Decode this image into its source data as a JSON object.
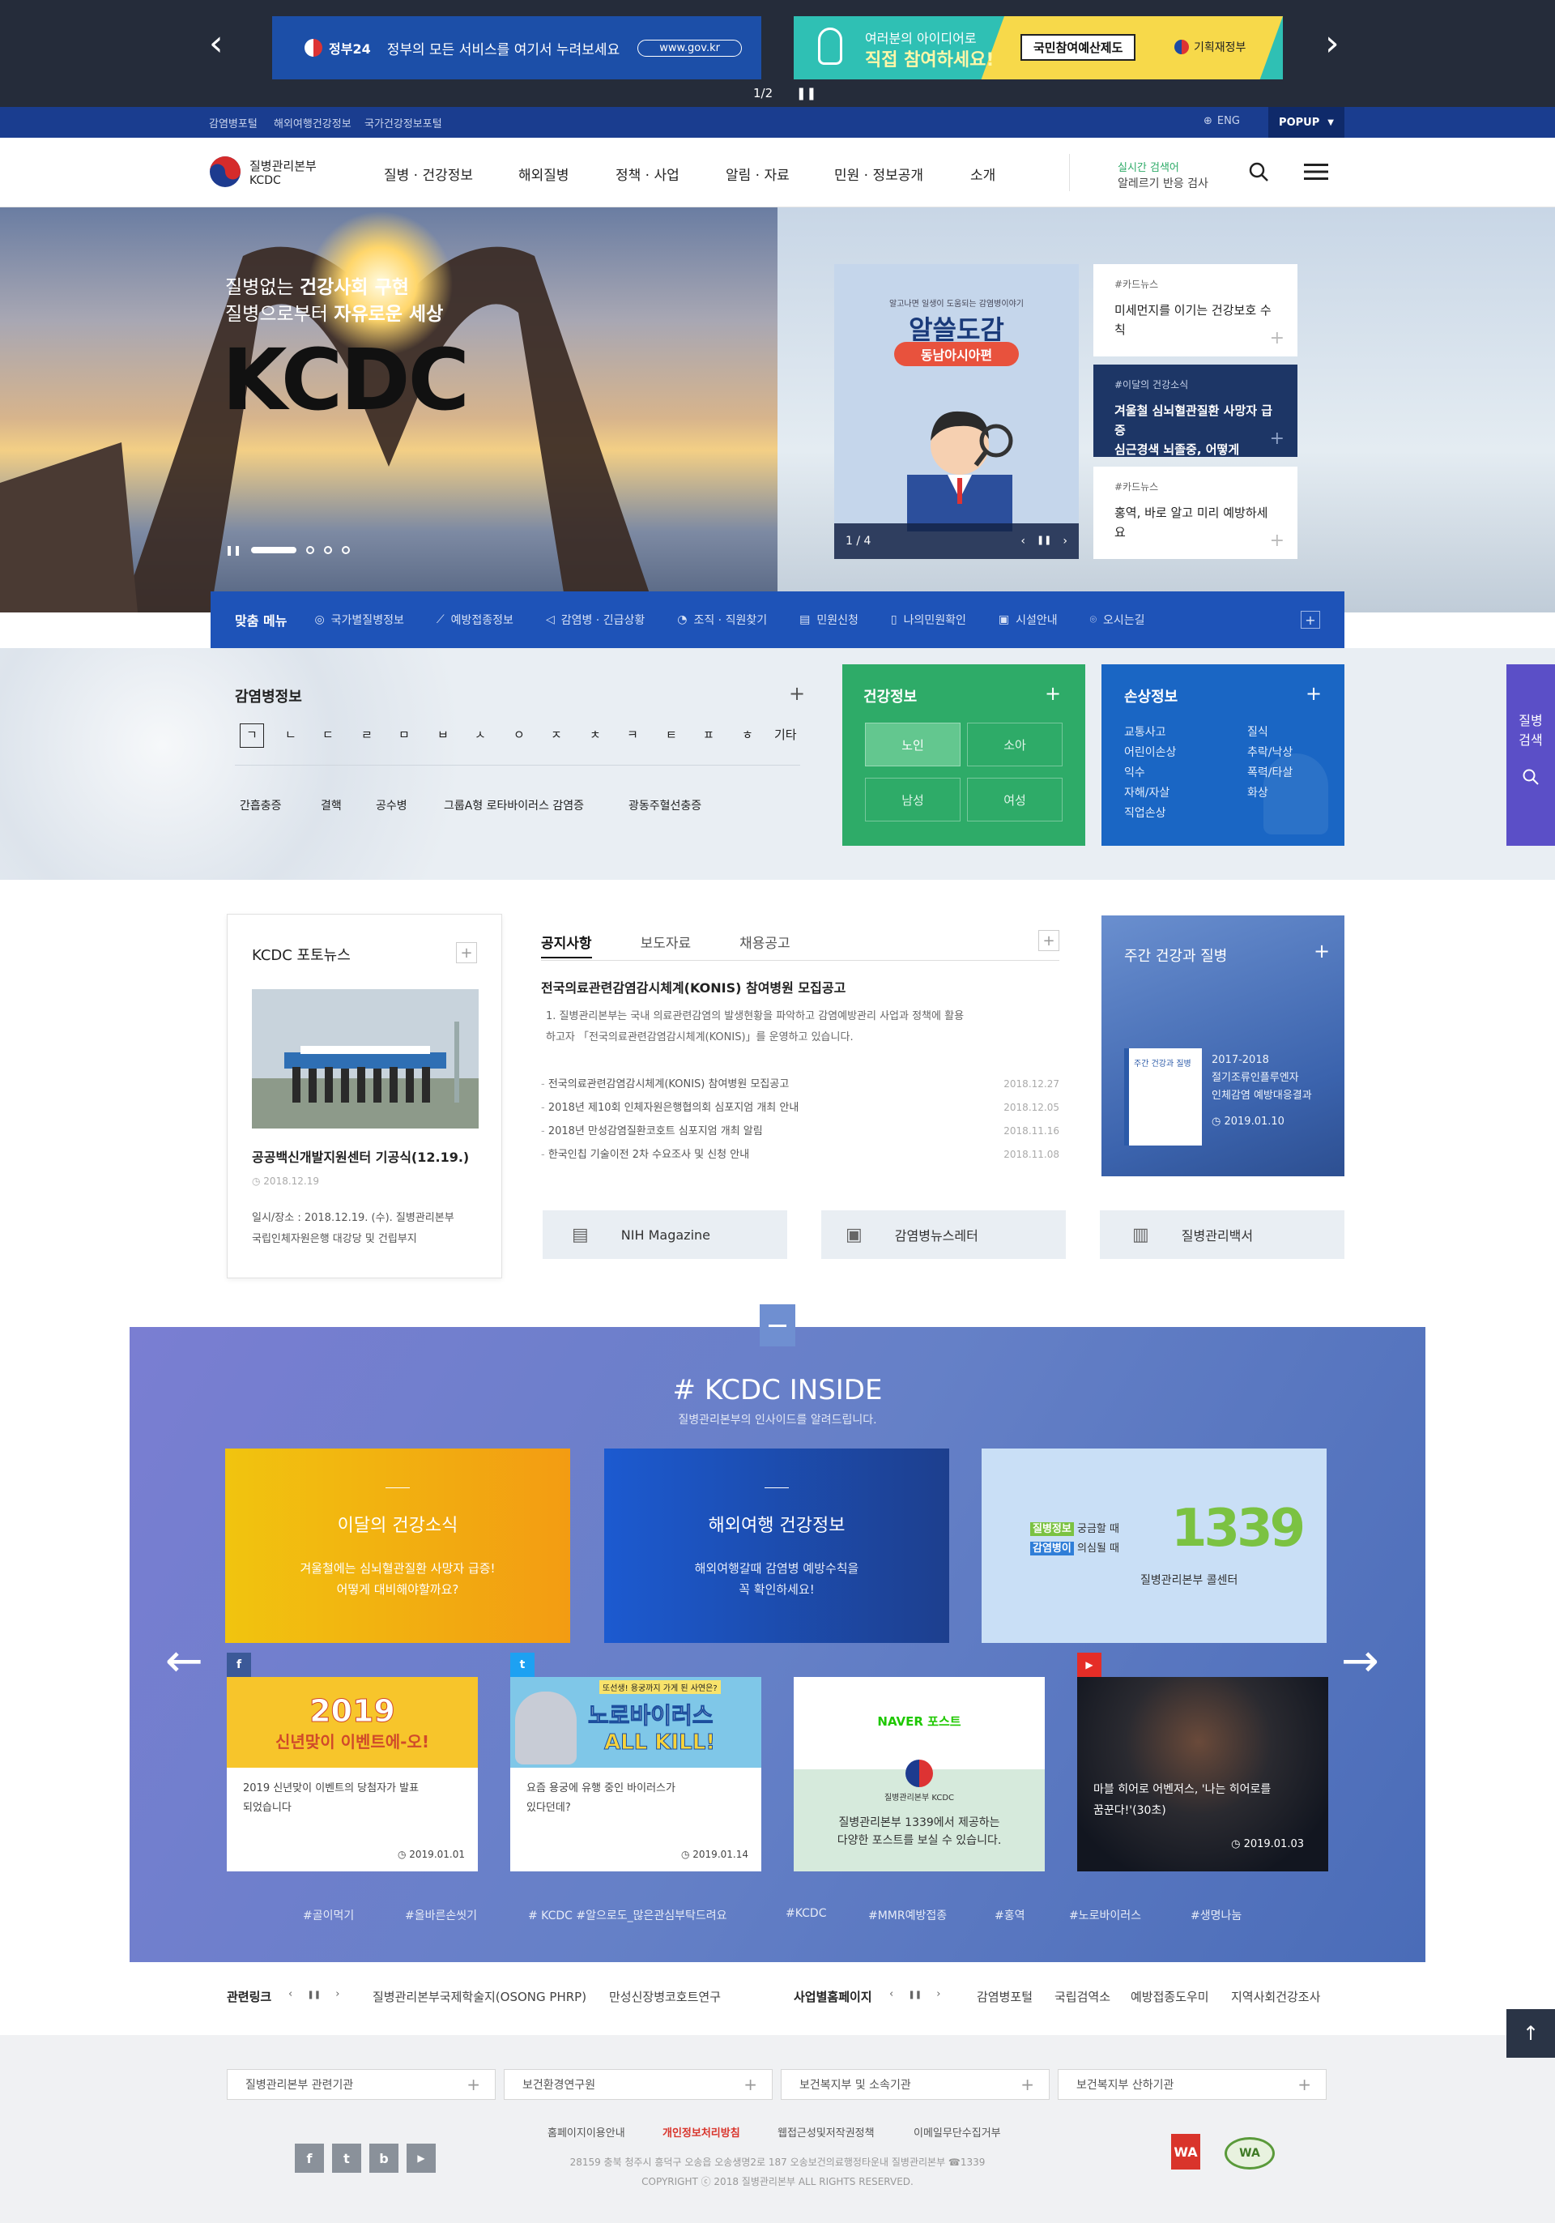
{
  "top_banner": {
    "gov24_logo": "정부24",
    "gov24_text": "정부의 모든 서비스를 여기서 누려보세요",
    "gov24_url": "www.gov.kr",
    "budget_line1": "여러분의 아이디어로",
    "budget_line2": "직접 참여하세요!",
    "budget_box": "국민참여예산제도",
    "budget_org": "기획재정부",
    "pager": "1/2"
  },
  "util": {
    "links": [
      "감염병포털",
      "해외여행건강정보",
      "국가건강정보포털"
    ],
    "lang": "ENG",
    "popup": "POPUP"
  },
  "header": {
    "logo_ko": "질병관리본부",
    "logo_en": "KCDC",
    "nav": [
      "질병 · 건강정보",
      "해외질병",
      "정책 · 사업",
      "알림 · 자료",
      "민원 · 정보공개",
      "소개"
    ],
    "realtime_label": "실시간 검색어",
    "realtime_value": "알레르기 반응 검사"
  },
  "hero": {
    "line1_a": "질병없는 ",
    "line1_b": "건강사회 구현",
    "line2_a": "질병으로부터 ",
    "line2_b": "자유로운 세상",
    "big": "KCDC",
    "bigcard_small": "알고나면 일생이 도움되는 감염병이야기",
    "bigcard_title": "알쓸도감",
    "bigcard_sub": "동남아시아편",
    "bigcard_pager": "1 / 4",
    "news": [
      {
        "tag": "#카드뉴스",
        "title": "미세먼지를 이기는 건강보호 수칙"
      },
      {
        "tag": "#이달의 건강소식",
        "title": "겨울철 심뇌혈관질환 사망자 급증\n심근경색 뇌졸중, 어떻게"
      },
      {
        "tag": "#카드뉴스",
        "title": "홍역, 바로 알고 미리 예방하세요"
      }
    ]
  },
  "quick_menu": {
    "label": "맞춤 메뉴",
    "items": [
      "국가별질병정보",
      "예방접종정보",
      "감염병 · 긴급상황",
      "조직 · 직원찾기",
      "민원신청",
      "나의민원확인",
      "시설안내",
      "오시는길"
    ]
  },
  "disease_info": {
    "title": "감염병정보",
    "consonants": [
      "ㄱ",
      "ㄴ",
      "ㄷ",
      "ㄹ",
      "ㅁ",
      "ㅂ",
      "ㅅ",
      "ㅇ",
      "ㅈ",
      "ㅊ",
      "ㅋ",
      "ㅌ",
      "ㅍ",
      "ㅎ",
      "기타"
    ],
    "diseases": [
      "간흡충증",
      "결핵",
      "공수병",
      "그룹A형 로타바이러스 감염증",
      "광동주혈선충증"
    ]
  },
  "health_info": {
    "title": "건강정보",
    "buttons": [
      "노인",
      "소아",
      "남성",
      "여성"
    ]
  },
  "injury_info": {
    "title": "손상정보",
    "col1": [
      "교통사고",
      "어린이손상",
      "익수",
      "자해/자살",
      "직업손상"
    ],
    "col2": [
      "질식",
      "추락/낙상",
      "폭력/타살",
      "화상"
    ]
  },
  "side_search": {
    "line1": "질병",
    "line2": "검색"
  },
  "photo_news": {
    "title": "KCDC 포토뉴스",
    "caption": "공공백신개발지원센터 기공식(12.19.)",
    "date": "2018.12.19",
    "desc1": "일시/장소 : 2018.12.19. (수). 질병관리본부",
    "desc2": "국립인체자원은행 대강당 및 건립부지"
  },
  "notice": {
    "tabs": [
      "공지사항",
      "보도자료",
      "채용공고"
    ],
    "headline": "전국의료관련감염감시체계(KONIS) 참여병원 모집공고",
    "summary1": "1. 질병관리본부는 국내 의료관련감염의 발생현황을 파악하고 감염예방관리 사업과 정책에 활용",
    "summary2": "하고자 「전국의료관련감염감시체계(KONIS)」를 운영하고 있습니다.",
    "items": [
      {
        "title": "전국의료관련감염감시체계(KONIS) 참여병원 모집공고",
        "date": "2018.12.27"
      },
      {
        "title": "2018년 제10회 인체자원은행협의회 심포지엄 개최 안내",
        "date": "2018.12.05"
      },
      {
        "title": "2018년 만성감염질환코호트 심포지엄 개최 알림",
        "date": "2018.11.16"
      },
      {
        "title": "한국인칩 기술이전 2차 수요조사 및 신청 안내",
        "date": "2018.11.08"
      }
    ]
  },
  "weekly": {
    "title": "주간 건강과 질병",
    "line1": "2017-2018",
    "line2": "절기조류인플루엔자",
    "line3": "인체감염 예방대응결과",
    "date": "2019.01.10"
  },
  "link_boxes": [
    "NIH Magazine",
    "감염병뉴스레터",
    "질병관리백서"
  ],
  "inside": {
    "title": "# KCDC INSIDE",
    "subtitle": "질병관리본부의 인사이드를 알려드립니다.",
    "box1_title": "이달의 건강소식",
    "box1_desc1": "겨울철에는 심뇌혈관질환 사망자 급증!",
    "box1_desc2": "어떻게 대비해야할까요?",
    "box2_title": "해외여행 건강정보",
    "box2_desc1": "해외여행갈때 감염병 예방수칙을",
    "box2_desc2": "꼭 확인하세요!",
    "box3_row1a": "질병정보",
    "box3_row1b": "궁금할 때",
    "box3_row2a": "감염병이",
    "box3_row2b": "의심될 때",
    "box3_number": "1339",
    "box3_caption": "질병관리본부 콜센터",
    "sns": [
      {
        "icon": "f",
        "img_title": "2019",
        "img_sub": "신년맞이 이벤트에-오!",
        "text1": "2019 신년맞이 이벤트의 당첨자가 발표",
        "text2": "되었습니다",
        "date": "2019.01.01"
      },
      {
        "icon": "t",
        "img_title": "노로바이러스",
        "img_sub": "ALL KILL!",
        "img_top": "또선생! 용궁까지 가게 된 사연은?",
        "text1": "요즘 용궁에 유행 중인 바이러스가",
        "text2": "있다던데?",
        "date": "2019.01.14"
      },
      {
        "icon": "N",
        "img_title": "NAVER 포스트",
        "img_sub": "질병관리본부 KCDC",
        "text1": "질병관리본부 1339에서 제공하는",
        "text2": "다양한 포스트를 보실 수 있습니다.",
        "date": ""
      },
      {
        "icon": "▶",
        "img_title": "",
        "img_sub": "",
        "text1": "마블 히어로 어벤저스, '나는 히어로를",
        "text2": "꿈꾼다!'(30초)",
        "date": "2019.01.03"
      }
    ],
    "hashtags": [
      "#골이먹기",
      "#올바른손씻기",
      "# KCDC #알으로도_많은관심부탁드려요",
      "#KCDC",
      "#MMR예방접종",
      "#홍역",
      "#노로바이러스",
      "#생명나눔"
    ]
  },
  "related": {
    "label1": "관련링크",
    "links1": [
      "질병관리본부국제학술지(OSONG PHRP)",
      "만성신장병코호트연구"
    ],
    "label2": "사업별홈페이지",
    "links2": [
      "감염병포털",
      "국립검역소",
      "예방접종도우미",
      "지역사회건강조사"
    ]
  },
  "footer": {
    "selects": [
      "질병관리본부 관련기관",
      "보건환경연구원",
      "보건복지부 및 소속기관",
      "보건복지부 산하기관"
    ],
    "links": [
      "홈페이지이용안내",
      "개인정보처리방침",
      "웹접근성및저작권정책",
      "이메일무단수집거부"
    ],
    "address": "28159 충북 청주시 흥덕구 오송읍 오송생명2로 187 오송보건의료행정타운내 질병관리본부 ☎1339",
    "copyright": "COPYRIGHT ⓒ 2018 질병관리본부 ALL RIGHTS RESERVED.",
    "accent": "#d9342b"
  }
}
